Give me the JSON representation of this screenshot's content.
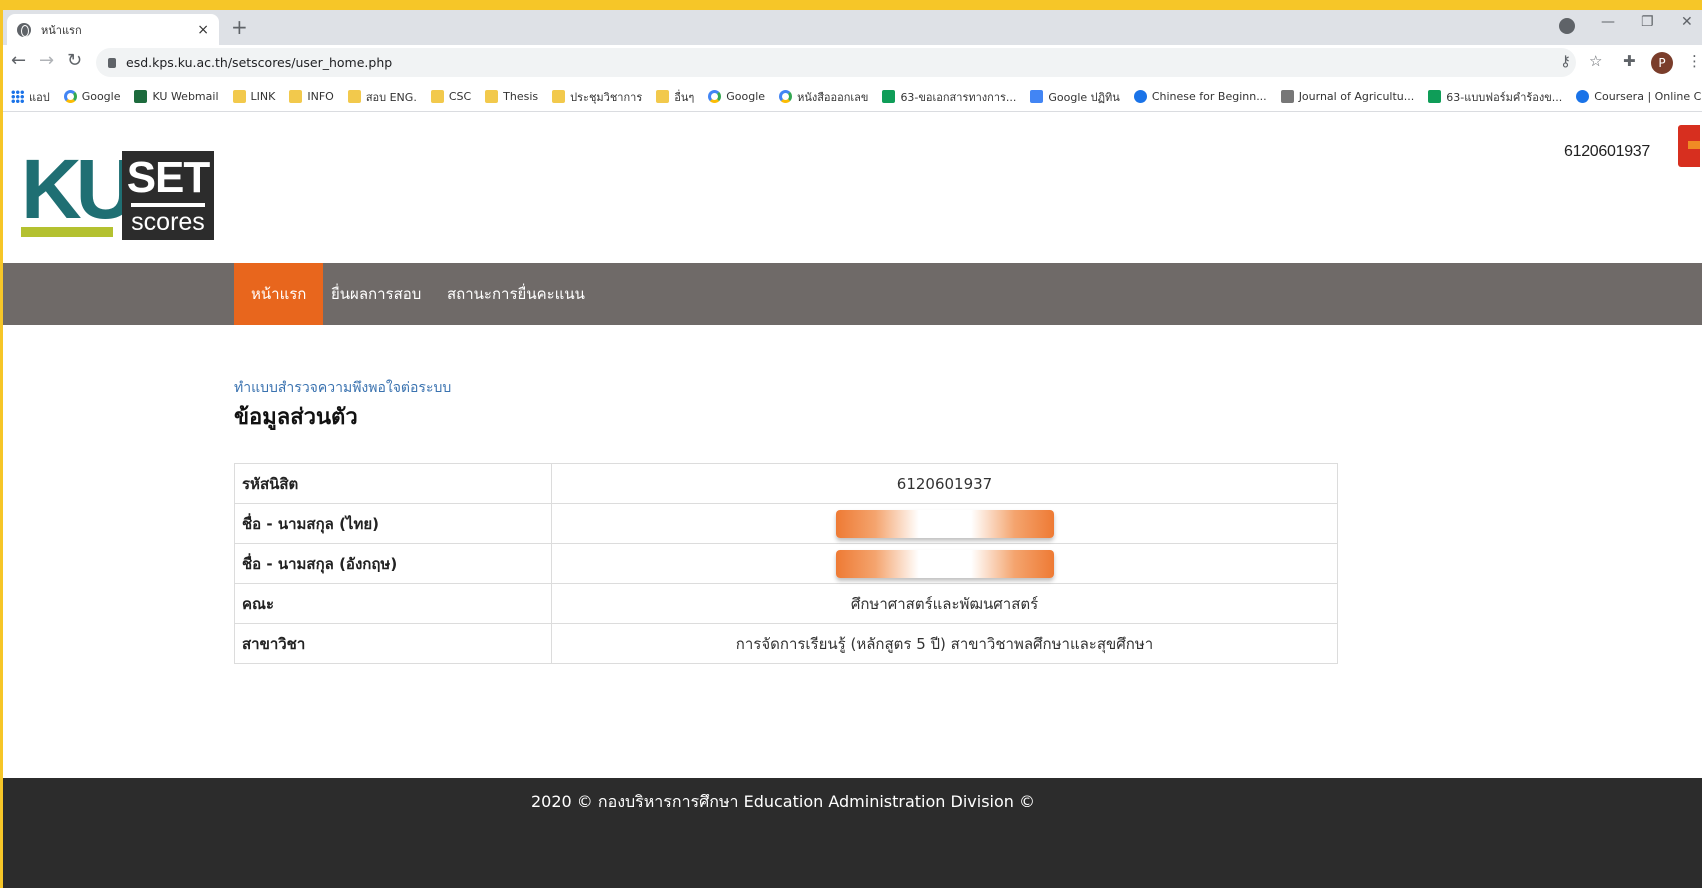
{
  "browser": {
    "tab_title": "หน้าแรก",
    "tab_close": "×",
    "new_tab": "+",
    "url": "esd.kps.ku.ac.th/setscores/user_home.php",
    "profile_initial": "P",
    "bookmarks": [
      {
        "label": "แอป",
        "icon": "apps"
      },
      {
        "label": "Google",
        "icon": "g"
      },
      {
        "label": "KU Webmail",
        "icon": "ku"
      },
      {
        "label": "LINK",
        "icon": "folder"
      },
      {
        "label": "INFO",
        "icon": "folder"
      },
      {
        "label": "สอบ ENG.",
        "icon": "folder"
      },
      {
        "label": "CSC",
        "icon": "folder"
      },
      {
        "label": "Thesis",
        "icon": "folder"
      },
      {
        "label": "ประชุมวิชาการ",
        "icon": "folder"
      },
      {
        "label": "อื่นๆ",
        "icon": "folder"
      },
      {
        "label": "Google",
        "icon": "g"
      },
      {
        "label": "หนังสือออกเลข",
        "icon": "g"
      },
      {
        "label": "63-ขอเอกสารทางการ...",
        "icon": "sheet"
      },
      {
        "label": "Google ปฏิทิน",
        "icon": "doc"
      },
      {
        "label": "Chinese for Beginn...",
        "icon": "c"
      },
      {
        "label": "Journal of Agricultu...",
        "icon": "ikp"
      },
      {
        "label": "63-แบบฟอร์มคำร้องข...",
        "icon": "sheet"
      },
      {
        "label": "Coursera | Online C...",
        "icon": "c"
      }
    ]
  },
  "header": {
    "logo_ku": "KU",
    "logo_set": "SET",
    "logo_scores": "scores",
    "user_id": "6120601937"
  },
  "menu": {
    "home": "หน้าแรก",
    "submit": "ยื่นผลการสอบ",
    "status": "สถานะการยื่นคะแนน"
  },
  "main": {
    "survey_link": "ทำแบบสำรวจความพึงพอใจต่อระบบ",
    "section_title": "ข้อมูลส่วนตัว",
    "rows": [
      {
        "label": "รหัสนิสิต",
        "value": "6120601937"
      },
      {
        "label": "ชื่อ - นามสกุล (ไทย)",
        "value": ""
      },
      {
        "label": "ชื่อ - นามสกุล (อังกฤษ)",
        "value": ""
      },
      {
        "label": "คณะ",
        "value": "ศึกษาศาสตร์และพัฒนศาสตร์"
      },
      {
        "label": "สาขาวิชา",
        "value": "การจัดการเรียนรู้ (หลักสูตร 5 ปี) สาขาวิชาพลศึกษาและสุขศึกษา"
      }
    ]
  },
  "footer": {
    "text": "2020 © กองบริหารการศึกษา Education Administration Division ©"
  },
  "colors": {
    "menu_active": "#e8661d",
    "menu_bar": "#6f6a68",
    "footer_bg": "#2c2c2c",
    "link": "#3b73b0",
    "ku_teal": "#1f6f73",
    "ku_lime": "#b4c130",
    "frame_border": "#f6c628"
  }
}
